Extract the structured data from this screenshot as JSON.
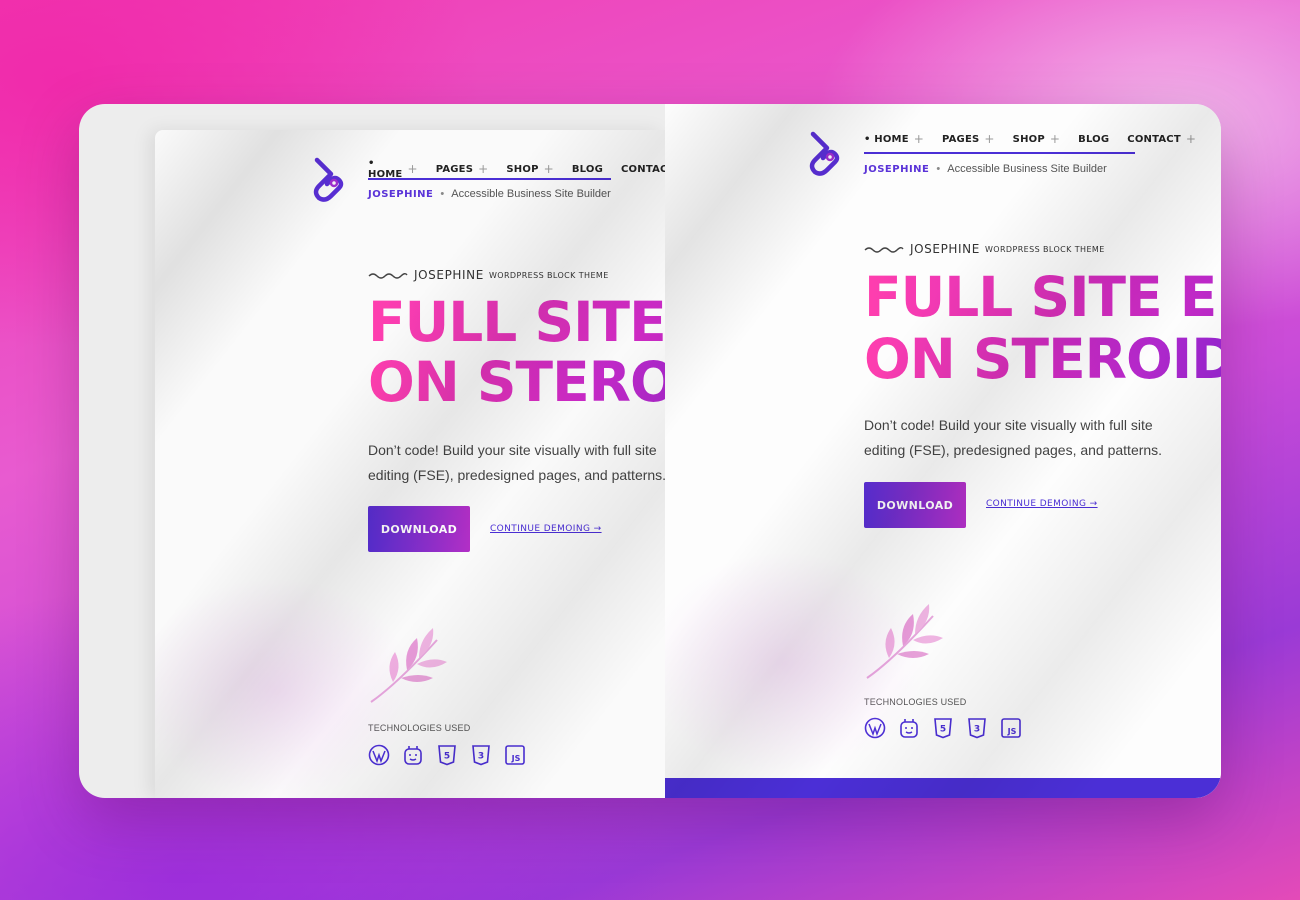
{
  "nav": {
    "items": [
      {
        "label": "• HOME",
        "plus": "+"
      },
      {
        "label": "PAGES",
        "plus": "+"
      },
      {
        "label": "SHOP",
        "plus": "+"
      },
      {
        "label": "BLOG",
        "plus": ""
      },
      {
        "label": "CONTACT",
        "plus": "+"
      }
    ]
  },
  "tagline": {
    "brand": "JOSEPHINE",
    "dot": "•",
    "text": "Accessible Business Site Builder"
  },
  "eyebrow": {
    "name": "JOSEPHINE",
    "sub": "WORDPRESS BLOCK THEME"
  },
  "hero": {
    "line1": "FULL SITE EDITING",
    "line2": "ON STEROIDS",
    "desc_line1": "Don’t code! Build your site visually with full site",
    "desc_line2": "editing (FSE), predesigned pages, and patterns."
  },
  "buttons": {
    "download": "DOWNLOAD",
    "demo": "CONTINUE DEMOING →"
  },
  "tech": {
    "label": "TECHNOLOGIES USED",
    "icons": [
      "wordpress-icon",
      "gutenberg-icon",
      "html5-icon",
      "css3-icon",
      "javascript-icon"
    ],
    "html5": "5",
    "css3": "3",
    "js": "JS"
  },
  "colors": {
    "accent": "#4b2fd6",
    "gradient_start": "#ff3fae",
    "gradient_end": "#8a24d6",
    "background_pink": "#f23ab0"
  }
}
